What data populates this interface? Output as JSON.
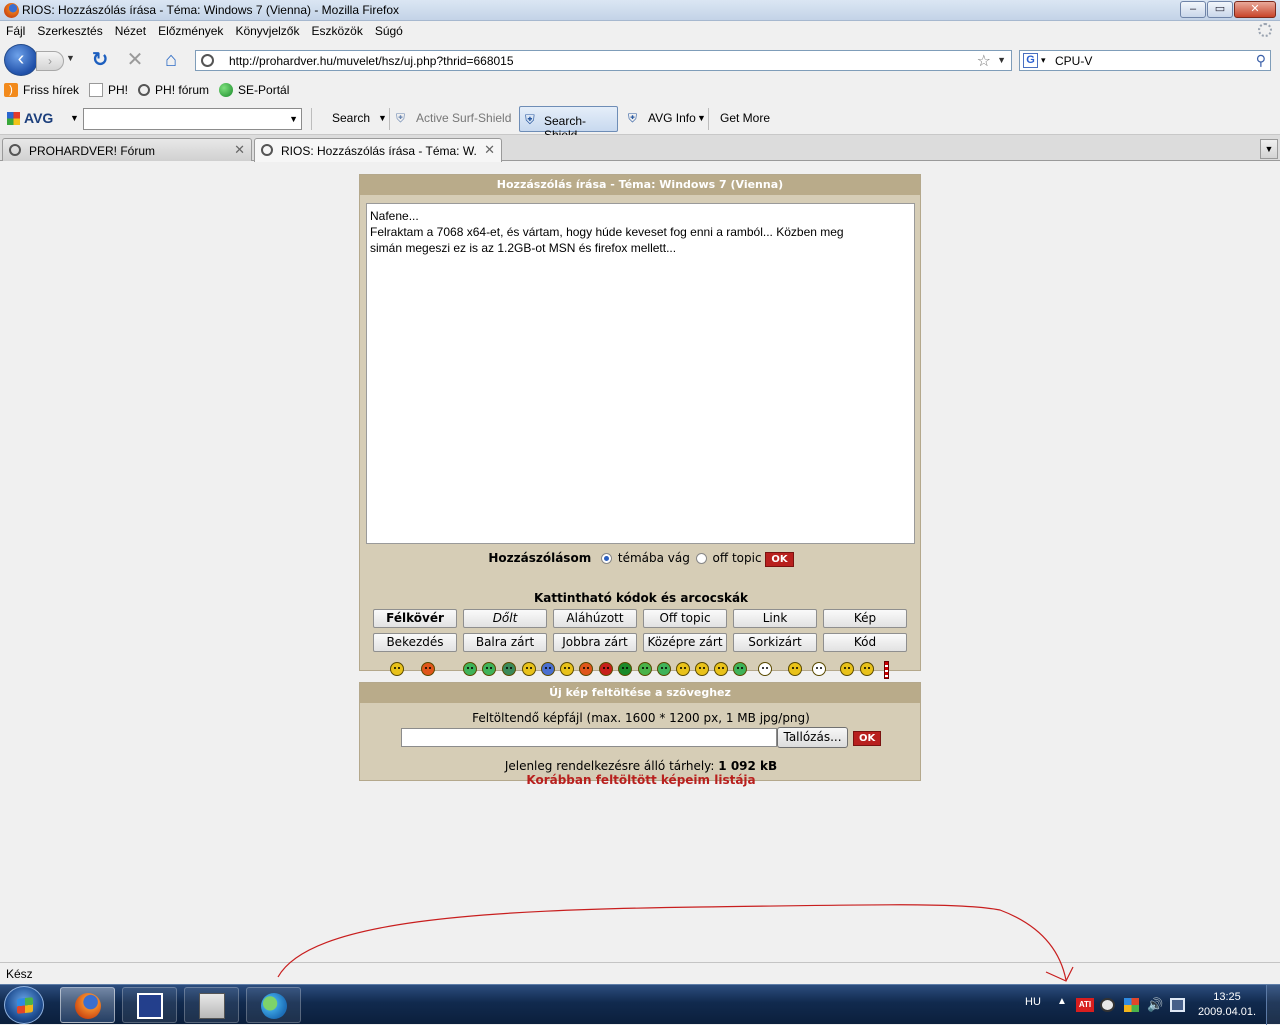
{
  "window": {
    "title": "RIOS: Hozzászólás írása - Téma: Windows 7 (Vienna) - Mozilla Firefox",
    "controls": {
      "minimize": "–",
      "maximize": "▭",
      "close": "✕"
    }
  },
  "menu": [
    "Fájl",
    "Szerkesztés",
    "Nézet",
    "Előzmények",
    "Könyvjelzők",
    "Eszközök",
    "Súgó"
  ],
  "nav": {
    "url": "http://prohardver.hu/muvelet/hsz/uj.php?thrid=668015",
    "search_value": "CPU-V",
    "search_engine_glyph": "G",
    "icons": {
      "back": "back-arrow-icon",
      "forward": "forward-arrow-icon",
      "reload": "reload-icon",
      "stop": "stop-icon",
      "home": "home-icon"
    }
  },
  "bookmarks": [
    {
      "label": "Friss hírek",
      "icon": "rss-icon"
    },
    {
      "label": "PH!",
      "icon": "page-icon"
    },
    {
      "label": "PH! fórum",
      "icon": "ph-icon"
    },
    {
      "label": "SE-Portál",
      "icon": "se-icon"
    }
  ],
  "avg_toolbar": {
    "logo": "AVG",
    "search": "Search",
    "active_surf_shield": "Active Surf-Shield",
    "search_shield": "Search-Shield",
    "avg_info": "AVG Info",
    "get_more": "Get More"
  },
  "tabs": [
    {
      "label": "PROHARDVER! Fórum",
      "active": false
    },
    {
      "label": "RIOS: Hozzászólás írása - Téma: W...",
      "active": true
    }
  ],
  "post_form": {
    "header": "Hozzászólás írása - Téma: Windows 7 (Vienna)",
    "text_lines": [
      "Nafene...",
      "Felraktam a 7068 x64-et, és vártam, hogy húde keveset fog enni a ramból... Közben meg",
      "simán megeszi ez is az 1.2GB-ot MSN és firefox mellett..."
    ],
    "post_type_label": "Hozzászólásom",
    "option_on_topic": "témába vág",
    "option_off_topic": "off topic",
    "ok": "OK",
    "codes_title": "Kattintható kódok és arcocskák",
    "code_buttons_row1": [
      "Félkövér",
      "Dőlt",
      "Aláhúzott",
      "Off topic",
      "Link",
      "Kép"
    ],
    "code_buttons_row2": [
      "Bekezdés",
      "Balra zárt",
      "Jobbra zárt",
      "Középre zárt",
      "Sorkizárt",
      "Kód"
    ]
  },
  "smileys": {
    "colors": [
      "#e9c21a",
      "#e0561b",
      "#3fb35a",
      "#3fb35a",
      "#3a8a5a",
      "#e9c21a",
      "#4a6fd0",
      "#e9c21a",
      "#e0561b",
      "#c8201a",
      "#1a8a2a",
      "#4ab34a",
      "#3fb35a",
      "#e9c21a",
      "#e9c21a",
      "#e9c21a",
      "#3fb35a",
      "#ffffff",
      "#e9c21a",
      "#ffffff",
      "#e9c21a",
      "#e9c21a",
      "#ffffff"
    ]
  },
  "upload": {
    "header": "Új kép feltöltése a szöveghez",
    "caption": "Feltöltendő képfájl (max. 1600 * 1200 px, 1 MB jpg/png)",
    "browse": "Tallózás...",
    "ok": "OK",
    "quota_label": "Jelenleg rendelkezésre álló tárhely:",
    "quota_value": "1 092 kB",
    "previous_link": "Korábban feltöltött képeim listája"
  },
  "status": {
    "text": "Kész"
  },
  "taskbar": {
    "language": "HU",
    "time": "13:25",
    "date": "2009.04.01.",
    "tray_ati": "ATI",
    "tray_up_arrow": "▲",
    "tray_volume": "🔊"
  },
  "annotation": {
    "color": "#c81e1e"
  }
}
